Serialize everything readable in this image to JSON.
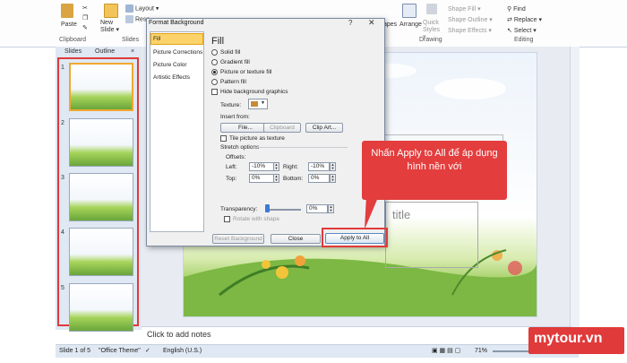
{
  "ribbon": {
    "paste": "Paste",
    "new_slide": "New Slide ▾",
    "layout": "Layout ▾",
    "reset": "Rese",
    "clipboard": "Clipboard",
    "slides": "Slides",
    "apes": "apes",
    "arrange": "Arrange",
    "quick": "Quick Styles ▾",
    "shape_fill": "Shape Fill ▾",
    "shape_outline": "Shape Outline ▾",
    "shape_effects": "Shape Effects ▾",
    "drawing": "Drawing",
    "find": "Find",
    "replace": "Replace ▾",
    "select": "Select ▾",
    "editing": "Editing"
  },
  "left_pane": {
    "tab_slides": "Slides",
    "tab_outline": "Outline",
    "close": "×",
    "thumb_numbers": [
      "1",
      "2",
      "3",
      "4",
      "5"
    ]
  },
  "dialog": {
    "title": "Format Background",
    "help": "?",
    "close": "✕",
    "nav": [
      "Fill",
      "Picture Corrections",
      "Picture Color",
      "Artistic Effects"
    ],
    "fill_heading": "Fill",
    "solid_fill": "Solid fill",
    "gradient_fill": "Gradient fill",
    "picture_fill": "Picture or texture fill",
    "pattern_fill": "Pattern fill",
    "hide_graphics": "Hide background graphics",
    "texture": "Texture:",
    "insert_from": "Insert from:",
    "file_btn": "File...",
    "clipboard_btn": "Clipboard",
    "clipart_btn": "Clip Art...",
    "tile": "Tile picture as texture",
    "stretch": "Stretch options",
    "offsets": "Offsets:",
    "left_label": "Left:",
    "left_val": "-10%",
    "right_label": "Right:",
    "right_val": "-10%",
    "top_label": "Top:",
    "top_val": "0%",
    "bottom_label": "Bottom:",
    "bottom_val": "0%",
    "transparency": "Transparency:",
    "transparency_val": "0%",
    "rotate": "Rotate with shape",
    "reset_btn": "Reset Background",
    "close_btn": "Close",
    "apply_btn": "Apply to All"
  },
  "slide": {
    "title_placeholder": "title"
  },
  "notes": {
    "placeholder": "Click to add notes"
  },
  "status": {
    "slide_count": "Slide 1 of 5",
    "theme": "\"Office Theme\"",
    "language": "English (U.S.)",
    "zoom": "71%"
  },
  "callout": {
    "text": "Nhấn Apply to All để áp dụng hình nền với"
  },
  "watermark": "mytour.vn"
}
